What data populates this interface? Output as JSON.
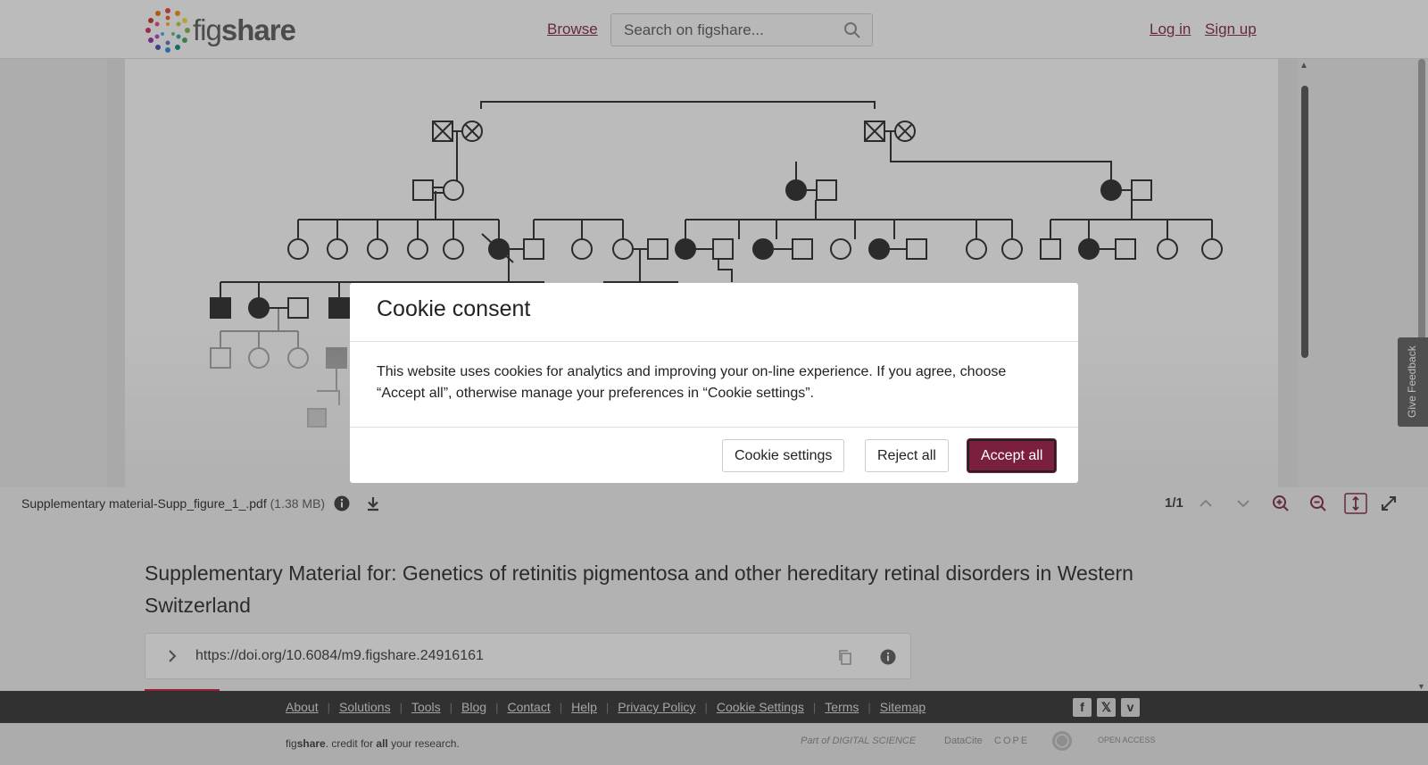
{
  "header": {
    "logo_text_light": "fig",
    "logo_text_bold": "share",
    "browse": "Browse",
    "search_placeholder": "Search on figshare...",
    "login": "Log in",
    "signup": "Sign up"
  },
  "viewer": {
    "file_name": "Supplementary material-Supp_figure_1_.pdf",
    "file_size": "(1.38 MB)",
    "page_indicator": "1/1"
  },
  "item": {
    "title": "Supplementary Material for: Genetics of retinitis pigmentosa and other hereditary retinal disorders in Western Switzerland",
    "doi": "https://doi.org/10.6084/m9.figshare.24916161"
  },
  "feedback": "Give Feedback",
  "footer": {
    "links": [
      "About",
      "Solutions",
      "Tools",
      "Blog",
      "Contact",
      "Help",
      "Privacy Policy",
      "Cookie Settings",
      "Terms",
      "Sitemap"
    ],
    "tagline_fig": "fig",
    "tagline_share": "share",
    "tagline_mid": ". credit for ",
    "tagline_all": "all",
    "tagline_end": " your research.",
    "partners": [
      "Part of DIGITAL SCIENCE",
      "DataCite",
      "COPE",
      "",
      "OPEN ACCESS"
    ]
  },
  "cookie": {
    "title": "Cookie consent",
    "body": "This website uses cookies for analytics and improving your on-line experience. If you agree, choose “Accept all”, otherwise manage your preferences in “Cookie settings”.",
    "settings": "Cookie settings",
    "reject": "Reject all",
    "accept": "Accept all"
  },
  "colors": {
    "brand": "#7a1f3d",
    "footer_dark": "#2b2b2b"
  }
}
